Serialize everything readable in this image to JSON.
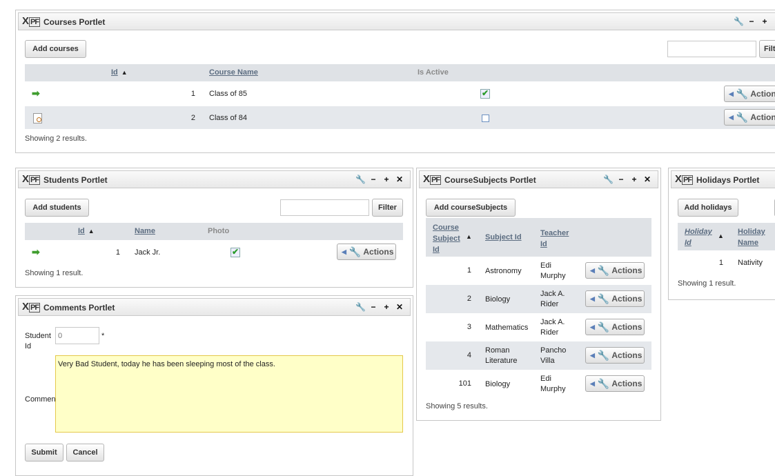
{
  "courses": {
    "title": "Courses Portlet",
    "add_label": "Add courses",
    "filter_label": "Filt",
    "columns": {
      "id": "Id",
      "name": "Course Name",
      "active": "Is Active"
    },
    "sort_indicator": "▲",
    "rows": [
      {
        "id": "1",
        "name": "Class of 85",
        "active": true,
        "actions": "Actions"
      },
      {
        "id": "2",
        "name": "Class of 84",
        "active": false,
        "actions": "Actions"
      }
    ],
    "status": "Showing 2 results."
  },
  "students": {
    "title": "Students Portlet",
    "add_label": "Add students",
    "filter_label": "Filter",
    "columns": {
      "id": "Id",
      "name": "Name",
      "photo": "Photo"
    },
    "sort_indicator": "▲",
    "rows": [
      {
        "id": "1",
        "name": "Jack Jr.",
        "photo": true,
        "actions": "Actions"
      }
    ],
    "status": "Showing 1 result."
  },
  "comments": {
    "title": "Comments Portlet",
    "student_id_label": "Student Id",
    "student_id_placeholder": "0",
    "required_marker": "*",
    "comment_label": "Comment",
    "comment_value": "Very Bad Student, today he has been sleeping most of the class.",
    "submit_label": "Submit",
    "cancel_label": "Cancel"
  },
  "course_subjects": {
    "title": "CourseSubjects Portlet",
    "add_label": "Add courseSubjects",
    "columns": {
      "id": "Course Subject Id",
      "subject": "Subject Id",
      "teacher": "Teacher Id"
    },
    "sort_indicator": "▲",
    "rows": [
      {
        "id": "1",
        "subject": "Astronomy",
        "teacher": "Edi Murphy",
        "actions": "Actions"
      },
      {
        "id": "2",
        "subject": "Biology",
        "teacher": "Jack A. Rider",
        "actions": "Actions"
      },
      {
        "id": "3",
        "subject": "Mathematics",
        "teacher": "Jack A. Rider",
        "actions": "Actions"
      },
      {
        "id": "4",
        "subject": "Roman Literature",
        "teacher": "Pancho Villa",
        "actions": "Actions"
      },
      {
        "id": "101",
        "subject": "Biology",
        "teacher": "Edi Murphy",
        "actions": "Actions"
      }
    ],
    "status": "Showing 5 results."
  },
  "holidays": {
    "title": "Holidays Portlet",
    "add_label": "Add holidays",
    "columns": {
      "id": "Holiday Id",
      "name": "Holiday Name"
    },
    "sort_indicator": "▲",
    "rows": [
      {
        "id": "1",
        "name": "Nativity"
      }
    ],
    "status": "Showing 1 result."
  },
  "icons": {
    "portlet_controls": [
      "wrench-icon",
      "minimize-icon",
      "maximize-icon",
      "close-icon"
    ],
    "edit_row": "green-arrow-icon",
    "view_row": "view-page-icon"
  },
  "colors": {
    "header_bg": "#dfe2e6",
    "alt_row": "#e5e8ec",
    "link": "#5b6c80",
    "comment_bg": "#ffffc8"
  }
}
